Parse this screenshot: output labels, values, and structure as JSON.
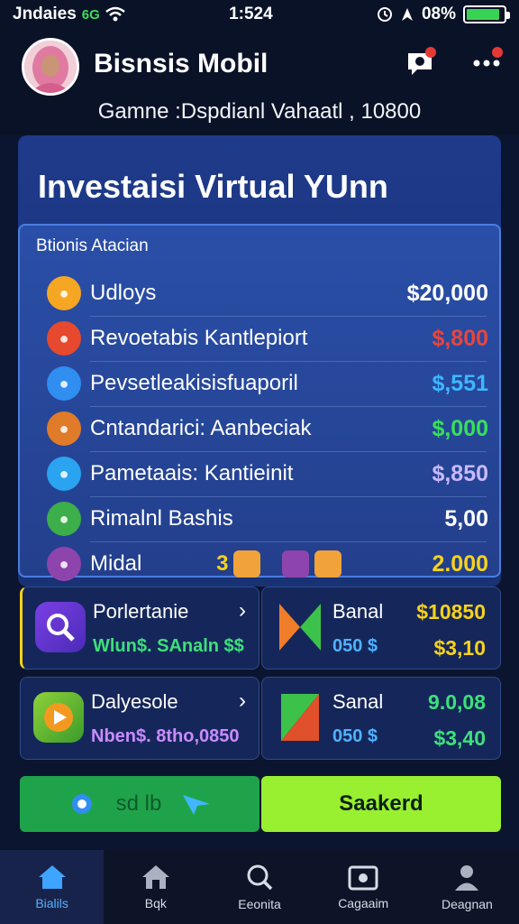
{
  "status": {
    "carrier": "Jndaies",
    "network": "6G",
    "time": "1:524",
    "battery": "08%",
    "battery_level": 0.9
  },
  "header": {
    "title": "Bisnsis Mobil",
    "subtitle": "Gamne :Dspdianl Vahaatl , 10800"
  },
  "panel": {
    "title": "Investaisi Virtual YUnn",
    "list_header": "Btionis Atacian",
    "rows": [
      {
        "label": "Udloys",
        "value": "$20,000",
        "icon": "coin-icon",
        "icon_color": "#f5a623",
        "value_color": "#ffffff"
      },
      {
        "label": "Revoetabis Kantlepiort",
        "value": "$,800",
        "icon": "tools-icon",
        "icon_color": "#e6492d",
        "value_color": "#e8453c"
      },
      {
        "label": "Pevsetleakisisfuaporil",
        "value": "$,551",
        "icon": "apps-icon",
        "icon_color": "#2f8ef0",
        "value_color": "#3fb6ff"
      },
      {
        "label": "Cntandarici: Aanbeciak",
        "value": "$,000",
        "icon": "gear-icon",
        "icon_color": "#e07b2a",
        "value_color": "#37e05a"
      },
      {
        "label": "Pametaais: Kantieinit",
        "value": "$,850",
        "icon": "cloud-icon",
        "icon_color": "#2aa3f0",
        "value_color": "#c9b9ff"
      },
      {
        "label": "Rimalnl Bashis",
        "value": "5,00",
        "icon": "chart-icon",
        "icon_color": "#3cae4a",
        "value_color": "#ffffff"
      },
      {
        "label": "Midal",
        "value": "2.000",
        "icon": "cross-icon",
        "icon_color": "#8e44ad",
        "value_color": "#f7d21c",
        "extra_num": "3"
      }
    ]
  },
  "cards": [
    {
      "title": "Porlertanie",
      "sub": "Wlun$. SAnaln $$",
      "sub_color": "#3de07a"
    },
    {
      "title": "Banal",
      "top": "$10850",
      "sub": "050 $",
      "bottom": "$3,10",
      "top_color": "#f7d21c",
      "bottom_color": "#f7d21c"
    },
    {
      "title": "Dalyesole",
      "sub": "Nben$. 8tho,0850",
      "sub_color": "#c98bff"
    },
    {
      "title": "Sanal",
      "top": "9.0,08",
      "sub": "050 $",
      "bottom": "$3,40",
      "top_color": "#3de07a",
      "bottom_color": "#3de07a"
    }
  ],
  "actions": {
    "left_label": "sd lb",
    "right_label": "Saakerd"
  },
  "nav": [
    {
      "label": "Bialils",
      "icon": "home-icon"
    },
    {
      "label": "Bqk",
      "icon": "store-icon"
    },
    {
      "label": "Eeonita",
      "icon": "search-icon"
    },
    {
      "label": "Cagaaim",
      "icon": "camera-icon"
    },
    {
      "label": "Deagnan",
      "icon": "profile-icon"
    }
  ]
}
